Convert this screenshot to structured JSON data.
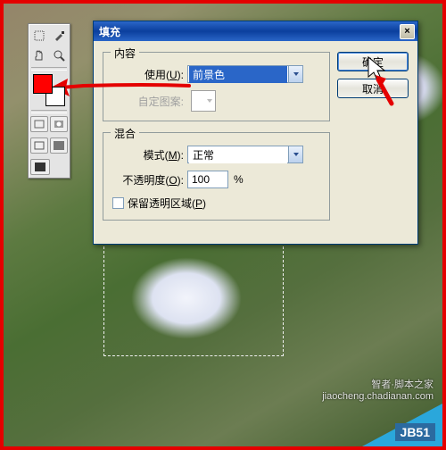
{
  "dialog": {
    "title": "填充",
    "groups": {
      "content": {
        "legend": "内容",
        "use_label": "使用(",
        "use_key": "U",
        "use_after": "):",
        "use_value": "前景色",
        "pattern_label": "自定图案:"
      },
      "blend": {
        "legend": "混合",
        "mode_label": "模式(",
        "mode_key": "M",
        "mode_after": "):",
        "mode_value": "正常",
        "opacity_label": "不透明度(",
        "opacity_key": "O",
        "opacity_after": "):",
        "opacity_value": "100",
        "opacity_unit": "%",
        "preserve_label": "保留透明区域(",
        "preserve_key": "P",
        "preserve_after": ")"
      }
    },
    "buttons": {
      "ok": "确定",
      "cancel": "取消"
    }
  },
  "toolbox": {
    "fg": "#ff0000",
    "bg": "#ffffff"
  },
  "watermark": {
    "host_cn": "智者·脚本之家",
    "host_en": "jiaocheng.chadianan.com",
    "corner": "JB51"
  }
}
